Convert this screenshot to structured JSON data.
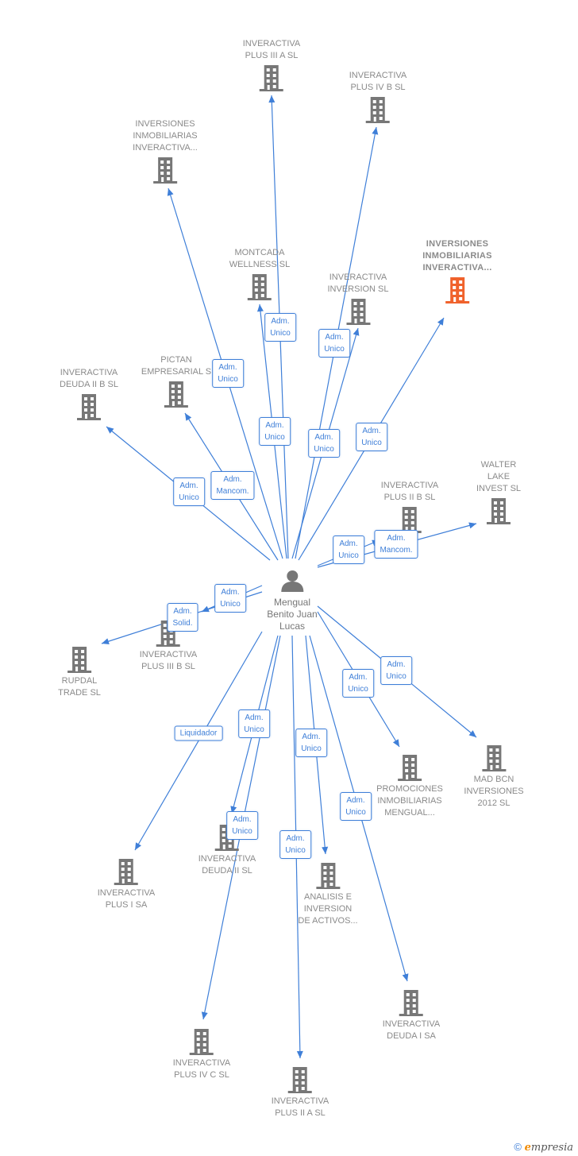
{
  "center": {
    "label_lines": [
      "Mengual",
      "Benito Juan",
      "Lucas"
    ],
    "icon": "person-icon"
  },
  "colors": {
    "edge": "#3f7fd8",
    "building": "#777777",
    "highlight_building": "#f0622c",
    "label": "#8a8a8a"
  },
  "companies": [
    {
      "id": "plus-iii-a",
      "lines": [
        "INVERACTIVA",
        "PLUS III A  SL"
      ]
    },
    {
      "id": "plus-iv-b",
      "lines": [
        "INVERACTIVA",
        "PLUS IV B  SL"
      ]
    },
    {
      "id": "inv-inmob-1",
      "lines": [
        "INVERSIONES",
        "INMOBILIARIAS",
        "INVERACTIVA..."
      ]
    },
    {
      "id": "montcada",
      "lines": [
        "MONTCADA",
        "WELLNESS  SL"
      ]
    },
    {
      "id": "inversion",
      "lines": [
        "INVERACTIVA",
        "INVERSION  SL"
      ]
    },
    {
      "id": "inv-inmob-2",
      "lines": [
        "INVERSIONES",
        "INMOBILIARIAS",
        "INVERACTIVA..."
      ],
      "highlight": true
    },
    {
      "id": "deuda-ii-b",
      "lines": [
        "INVERACTIVA",
        "DEUDA II B  SL"
      ]
    },
    {
      "id": "pictan",
      "lines": [
        "PICTAN",
        "EMPRESARIAL S"
      ]
    },
    {
      "id": "plus-ii-b",
      "lines": [
        "INVERACTIVA",
        "PLUS II B  SL"
      ]
    },
    {
      "id": "walter",
      "lines": [
        "WALTER",
        "LAKE",
        "INVEST SL"
      ]
    },
    {
      "id": "plus-iii-b",
      "lines": [
        "INVERACTIVA",
        "PLUS III B  SL"
      ]
    },
    {
      "id": "rupdal",
      "lines": [
        "RUPDAL",
        "TRADE  SL"
      ]
    },
    {
      "id": "promociones",
      "lines": [
        "PROMOCIONES",
        "INMOBILIARIAS",
        "MENGUAL..."
      ]
    },
    {
      "id": "mad-bcn",
      "lines": [
        "MAD BCN",
        "INVERSIONES",
        "2012 SL"
      ]
    },
    {
      "id": "plus-i",
      "lines": [
        "INVERACTIVA",
        "PLUS I SA"
      ]
    },
    {
      "id": "deuda-ii",
      "lines": [
        "INVERACTIVA",
        "DEUDA II  SL"
      ]
    },
    {
      "id": "analisis",
      "lines": [
        "ANALISIS E",
        "INVERSION",
        "DE ACTIVOS..."
      ]
    },
    {
      "id": "deuda-i",
      "lines": [
        "INVERACTIVA",
        "DEUDA I SA"
      ]
    },
    {
      "id": "plus-iv-c",
      "lines": [
        "INVERACTIVA",
        "PLUS IV C  SL"
      ]
    },
    {
      "id": "plus-ii-a",
      "lines": [
        "INVERACTIVA",
        "PLUS II A  SL"
      ]
    }
  ],
  "roles": [
    {
      "target": "plus-iii-a",
      "lines": [
        "Adm.",
        "Unico"
      ]
    },
    {
      "target": "plus-iv-b",
      "lines": [
        "Adm.",
        "Unico"
      ]
    },
    {
      "target": "inv-inmob-1",
      "lines": [
        "Adm.",
        "Unico"
      ]
    },
    {
      "target": "montcada",
      "lines": [
        "Adm.",
        "Unico"
      ]
    },
    {
      "target": "inversion",
      "lines": [
        "Adm.",
        "Unico"
      ]
    },
    {
      "target": "inv-inmob-2",
      "lines": [
        "Adm.",
        "Unico"
      ]
    },
    {
      "target": "deuda-ii-b",
      "lines": [
        "Adm.",
        "Unico"
      ]
    },
    {
      "target": "pictan",
      "lines": [
        "Adm.",
        "Mancom."
      ]
    },
    {
      "target": "plus-ii-b",
      "lines": [
        "Adm.",
        "Unico"
      ]
    },
    {
      "target": "walter",
      "lines": [
        "Adm.",
        "Mancom."
      ]
    },
    {
      "target": "plus-iii-b",
      "lines": [
        "Adm.",
        "Unico"
      ]
    },
    {
      "target": "rupdal",
      "lines": [
        "Adm.",
        "Solid."
      ]
    },
    {
      "target": "promociones",
      "lines": [
        "Adm.",
        "Unico"
      ]
    },
    {
      "target": "mad-bcn",
      "lines": [
        "Adm.",
        "Unico"
      ]
    },
    {
      "target": "plus-i",
      "lines": [
        "Liquidador"
      ]
    },
    {
      "target": "deuda-ii",
      "lines": [
        "Adm.",
        "Unico"
      ]
    },
    {
      "target": "analisis",
      "lines": [
        "Adm.",
        "Unico"
      ]
    },
    {
      "target": "deuda-i",
      "lines": [
        "Adm.",
        "Unico"
      ]
    },
    {
      "target": "plus-iv-c",
      "lines": [
        "Adm.",
        "Unico"
      ]
    },
    {
      "target": "plus-ii-a",
      "lines": [
        "Adm.",
        "Unico"
      ]
    }
  ],
  "footer": {
    "copyright": "©",
    "brand_initial": "e",
    "brand_rest": "mpresia"
  }
}
